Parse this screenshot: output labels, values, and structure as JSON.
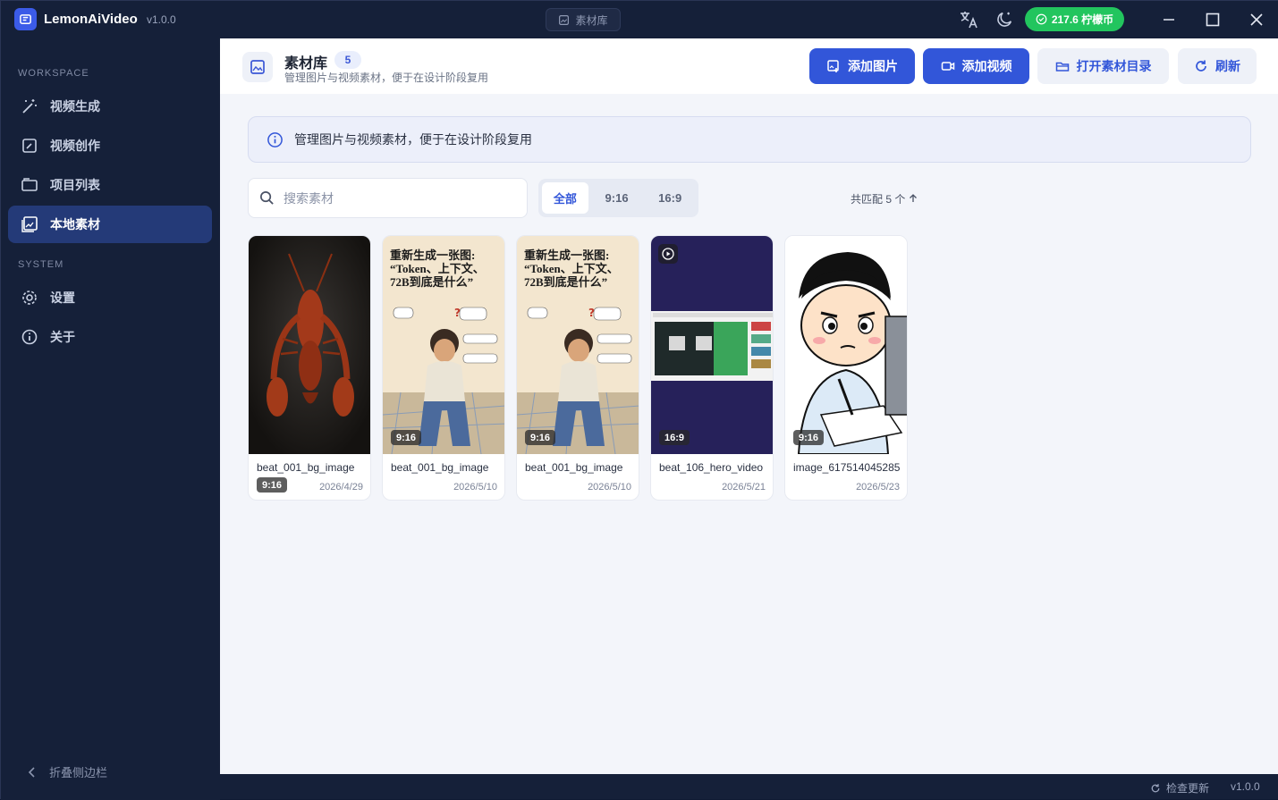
{
  "app": {
    "name": "LemonAiVideo",
    "version": "v1.0.0",
    "window_title": "素材库"
  },
  "top_right": {
    "coin_balance": "217.6 柠檬币"
  },
  "sidebar": {
    "workspace_label": "WORKSPACE",
    "system_label": "SYSTEM",
    "items": [
      {
        "label": "视频生成",
        "icon": "magic-wand-icon"
      },
      {
        "label": "视频创作",
        "icon": "edit-square-icon"
      },
      {
        "label": "项目列表",
        "icon": "folder-icon"
      },
      {
        "label": "本地素材",
        "icon": "image-gallery-icon",
        "active": true
      }
    ],
    "system_items": [
      {
        "label": "设置",
        "icon": "gear-icon"
      },
      {
        "label": "关于",
        "icon": "info-icon"
      }
    ],
    "collapse_label": "折叠侧边栏"
  },
  "header": {
    "title": "素材库",
    "count": "5",
    "subtitle": "管理图片与视频素材，便于在设计阶段复用",
    "buttons": {
      "add_image": "添加图片",
      "add_video": "添加视频",
      "open_folder": "打开素材目录",
      "refresh": "刷新"
    }
  },
  "info_bar": {
    "text": "管理图片与视频素材，便于在设计阶段复用"
  },
  "search": {
    "placeholder": "搜索素材",
    "value": ""
  },
  "filters": {
    "all": "全部",
    "portrait": "9:16",
    "landscape": "16:9",
    "selected": "全部"
  },
  "match_count": "共匹配 5 个",
  "assets": [
    {
      "name": "beat_001_bg_image",
      "date": "2026/4/29",
      "ratio": "9:16",
      "type": "image"
    },
    {
      "name": "beat_001_bg_image",
      "date": "2026/5/10",
      "ratio": "9:16",
      "type": "image"
    },
    {
      "name": "beat_001_bg_image",
      "date": "2026/5/10",
      "ratio": "9:16",
      "type": "image"
    },
    {
      "name": "beat_106_hero_video",
      "date": "2026/5/21",
      "ratio": "16:9",
      "type": "video"
    },
    {
      "name": "image_617514045285",
      "date": "2026/5/23",
      "ratio": "9:16",
      "type": "image"
    }
  ],
  "poster_text": {
    "line1": "重新生成一张图:",
    "line2": "“Token、上下文、",
    "line3": "72B到底是什么”"
  },
  "statusbar": {
    "check_update": "检查更新",
    "version": "v1.0.0"
  },
  "colors": {
    "accent": "#3256d9",
    "sidebar_bg": "#152039",
    "active_nav": "#243a78",
    "coin_green": "#22c55e"
  }
}
